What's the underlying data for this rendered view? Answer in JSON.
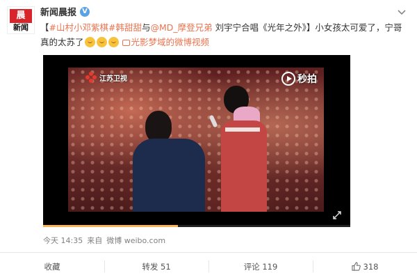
{
  "header": {
    "avatar_top": "晨",
    "avatar_bottom": "新闻",
    "author_name": "新闻晨报",
    "verified_mark": "V"
  },
  "post": {
    "tag1": "#山村小邓紫棋#",
    "mention1": "韩甜甜",
    "text1": "与",
    "mention2": "@MD_摩登兄弟",
    "text2": " 刘宇宁合唱《光年之外》】小女孩太可爱了，宁哥真的太苏了",
    "prefix": "【",
    "video_link": "光影梦域的微博视频"
  },
  "video": {
    "channel_name": "江苏卫视",
    "watermark_text": "秒拍",
    "progress": 0.44
  },
  "meta": {
    "time": "今天 14:35",
    "from_label": "来自",
    "source": "微博 weibo.com"
  },
  "actions": {
    "favorite": "收藏",
    "repost": "转发 51",
    "comment": "评论 119",
    "like": "318"
  },
  "colors": {
    "accent": "#eb7350",
    "verified": "#5ba2e4",
    "progress": "#f8b551"
  },
  "icons": [
    "verified-icon",
    "chevron-down-icon",
    "emoji-icon",
    "video-link-icon",
    "channel-logo-icon",
    "play-icon",
    "fullscreen-icon",
    "like-icon"
  ]
}
